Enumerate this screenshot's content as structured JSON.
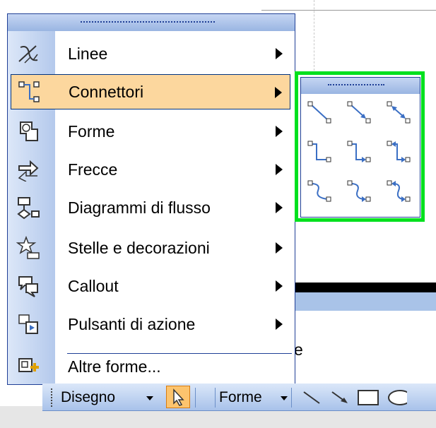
{
  "menu": {
    "items": [
      {
        "label": "Linee",
        "icon": "lines-icon",
        "has_submenu": true,
        "highlighted": false
      },
      {
        "label": "Connettori",
        "icon": "connectors-icon",
        "has_submenu": true,
        "highlighted": true
      },
      {
        "label": "Forme",
        "icon": "basic-shapes-icon",
        "has_submenu": true,
        "highlighted": false
      },
      {
        "label": "Frecce",
        "icon": "block-arrows-icon",
        "has_submenu": true,
        "highlighted": false
      },
      {
        "label": "Diagrammi di flusso",
        "icon": "flowchart-icon",
        "has_submenu": true,
        "highlighted": false
      },
      {
        "label": "Stelle e decorazioni",
        "icon": "stars-banners-icon",
        "has_submenu": true,
        "highlighted": false
      },
      {
        "label": "Callout",
        "icon": "callout-icon",
        "has_submenu": true,
        "highlighted": false
      },
      {
        "label": "Pulsanti di azione",
        "icon": "action-buttons-icon",
        "has_submenu": true,
        "highlighted": false
      },
      {
        "label": "Altre forme...",
        "icon": "more-shapes-icon",
        "has_submenu": false,
        "highlighted": false
      }
    ]
  },
  "submenu": {
    "connectors": [
      "straight-connector-icon",
      "straight-arrow-connector-icon",
      "straight-double-arrow-connector-icon",
      "elbow-connector-icon",
      "elbow-arrow-connector-icon",
      "elbow-double-arrow-connector-icon",
      "curved-connector-icon",
      "curved-arrow-connector-icon",
      "curved-double-arrow-connector-icon"
    ]
  },
  "toolbar": {
    "draw_label": "Disegno",
    "shapes_label": "Forme"
  },
  "document": {
    "partial_text": "e"
  },
  "colors": {
    "highlight": "#fcd79e",
    "menu_border": "#1f3f96",
    "focus_outline": "#00e01e",
    "connector_line": "#3b6fc4"
  }
}
